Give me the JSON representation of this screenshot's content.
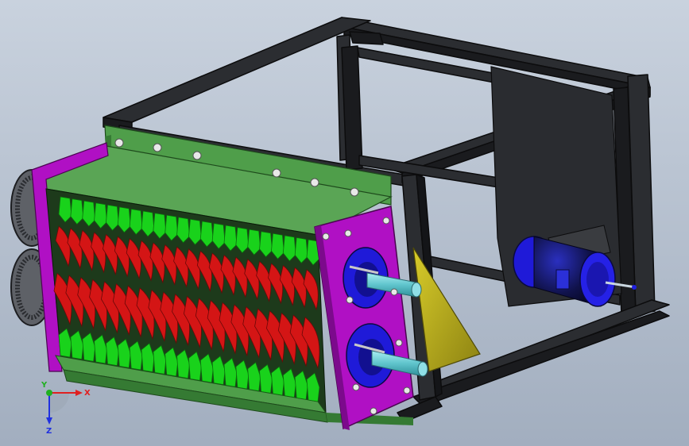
{
  "viewport": {
    "background_top": "#c9d2de",
    "background_bottom": "#a2aebf"
  },
  "colors": {
    "frame": "#2b2d31",
    "frame_edge": "#0c0c0d",
    "green_panel": "#4f9e4a",
    "green_dark": "#357a33",
    "magenta": "#b010c4",
    "magenta_dark": "#7c0a8c",
    "red_blade": "#d41515",
    "green_tooth": "#19d21b",
    "olive_plate": "#c3b61a",
    "motor_blue": "#1f1ad8",
    "shaft": "#6ad0d8",
    "bolt": "#e8e8e8"
  },
  "triad": {
    "x_label": "X",
    "y_label": "Y",
    "z_label": "Z",
    "x_color": "#e02020",
    "y_color": "#20b020",
    "z_color": "#2030e0",
    "x_icon": "arrow-right-icon",
    "z_icon": "arrow-down-icon"
  }
}
